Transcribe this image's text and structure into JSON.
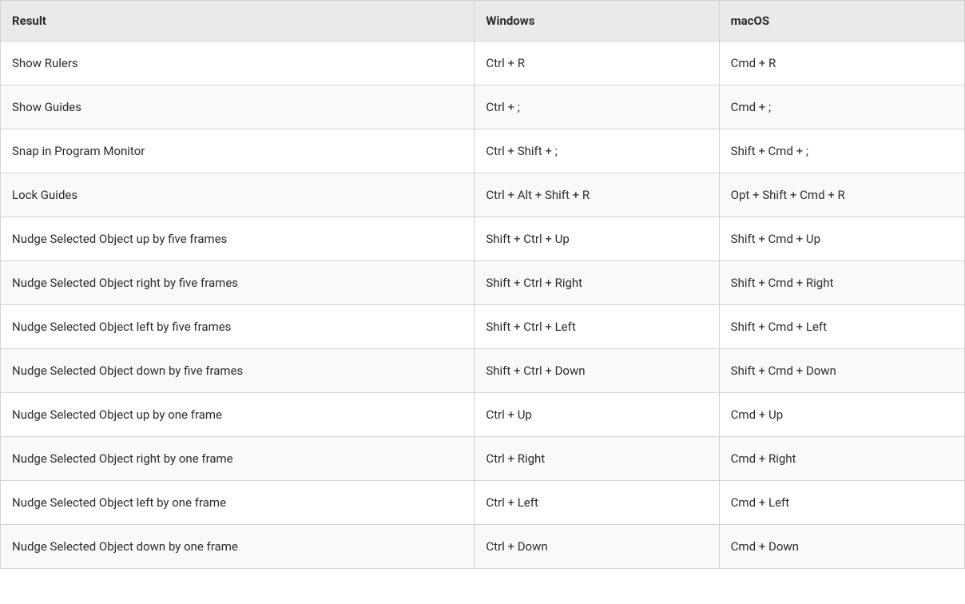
{
  "table": {
    "headers": {
      "result": "Result",
      "windows": "Windows",
      "macos": "macOS"
    },
    "rows": [
      {
        "result": "Show Rulers",
        "windows": "Ctrl + R",
        "macos": "Cmd + R"
      },
      {
        "result": "Show Guides",
        "windows": "Ctrl + ;",
        "macos": "Cmd + ;"
      },
      {
        "result": "Snap in Program Monitor",
        "windows": "Ctrl + Shift + ;",
        "macos": "Shift + Cmd + ;"
      },
      {
        "result": "Lock Guides",
        "windows": "Ctrl + Alt + Shift + R",
        "macos": "Opt + Shift + Cmd + R"
      },
      {
        "result": "Nudge Selected Object up by five frames",
        "windows": "Shift + Ctrl + Up",
        "macos": "Shift + Cmd + Up"
      },
      {
        "result": "Nudge Selected Object right by five frames",
        "windows": "Shift + Ctrl + Right",
        "macos": "Shift + Cmd + Right"
      },
      {
        "result": "Nudge Selected Object left by five frames",
        "windows": "Shift + Ctrl + Left",
        "macos": "Shift + Cmd + Left"
      },
      {
        "result": "Nudge Selected Object down by five frames",
        "windows": "Shift + Ctrl + Down",
        "macos": "Shift + Cmd + Down"
      },
      {
        "result": "Nudge Selected Object up by one frame",
        "windows": "Ctrl + Up",
        "macos": "Cmd + Up"
      },
      {
        "result": "Nudge Selected Object right by one frame",
        "windows": "Ctrl + Right",
        "macos": "Cmd + Right"
      },
      {
        "result": "Nudge Selected Object left by one frame",
        "windows": "Ctrl + Left",
        "macos": "Cmd + Left"
      },
      {
        "result": "Nudge Selected Object down by one frame",
        "windows": "Ctrl + Down",
        "macos": "Cmd + Down"
      }
    ]
  }
}
